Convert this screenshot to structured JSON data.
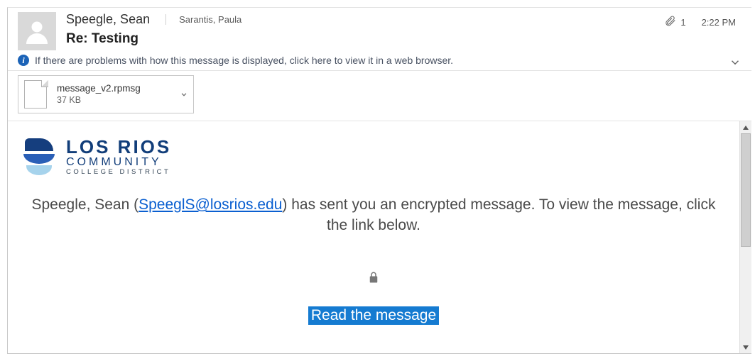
{
  "header": {
    "sender": "Speegle, Sean",
    "recipient": "Sarantis, Paula",
    "subject": "Re: Testing",
    "attachment_count": "1",
    "time": "2:22 PM"
  },
  "infobar": {
    "text": "If there are problems with how this message is displayed, click here to view it in a web browser."
  },
  "attachment": {
    "name": "message_v2.rpmsg",
    "size": "37 KB"
  },
  "body": {
    "logo": {
      "line1": "LOS RIOS",
      "line2": "COMMUNITY",
      "line3": "COLLEGE DISTRICT"
    },
    "msg_prefix": "Speegle, Sean (",
    "sender_email": "SpeeglS@losrios.edu",
    "msg_suffix": ") has sent you an encrypted message. To view the message, click the link below.",
    "read_link": "Read the message"
  }
}
